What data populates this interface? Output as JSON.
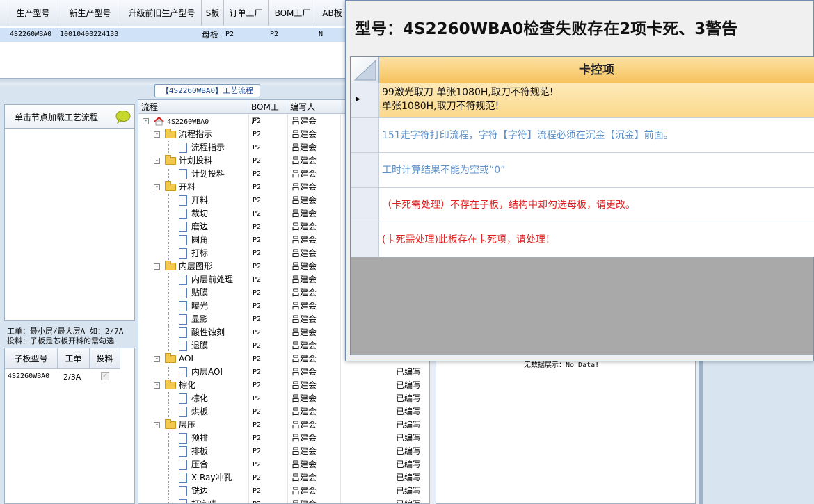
{
  "top_grid": {
    "columns": [
      "生产型号",
      "新生产型号",
      "升级前旧生产型号",
      "S板",
      "订单工厂",
      "BOM工厂",
      "AB板"
    ],
    "row": [
      "4S2260WBA0",
      "10010400224133",
      "",
      "母板",
      "P2",
      "P2",
      "N"
    ]
  },
  "left_panel": {
    "header": "单击节点加载工艺流程",
    "hint_line1": "工单：最小层/最大层A 如：2/7A",
    "hint_line2": "投料：子板是芯板开料的需勾选",
    "sub_grid": {
      "columns": [
        "子板型号",
        "工单",
        "投料"
      ],
      "row": [
        "4S2260WBA0",
        "2/3A",
        "✓"
      ]
    }
  },
  "process": {
    "title": "【4S2260WBA0】工艺流程",
    "columns": [
      "流程",
      "BOM工厂",
      "编写人"
    ],
    "root": "4S2260WBA0",
    "bom": "P2",
    "writer": "吕建会",
    "status": "已编写",
    "nodes": [
      {
        "name": "流程指示",
        "level": 1
      },
      {
        "name": "流程指示",
        "level": 2
      },
      {
        "name": "计划投料",
        "level": 1
      },
      {
        "name": "计划投料",
        "level": 2
      },
      {
        "name": "开料",
        "level": 1
      },
      {
        "name": "开料",
        "level": 2
      },
      {
        "name": "裁切",
        "level": 2
      },
      {
        "name": "磨边",
        "level": 2
      },
      {
        "name": "圆角",
        "level": 2
      },
      {
        "name": "打标",
        "level": 2
      },
      {
        "name": "内层图形",
        "level": 1
      },
      {
        "name": "内层前处理",
        "level": 2
      },
      {
        "name": "贴膜",
        "level": 2
      },
      {
        "name": "曝光",
        "level": 2
      },
      {
        "name": "显影",
        "level": 2
      },
      {
        "name": "酸性蚀刻",
        "level": 2
      },
      {
        "name": "退膜",
        "level": 2
      },
      {
        "name": "AOI",
        "level": 1
      },
      {
        "name": "内层AOI",
        "level": 2
      },
      {
        "name": "棕化",
        "level": 1
      },
      {
        "name": "棕化",
        "level": 2
      },
      {
        "name": "烘板",
        "level": 2
      },
      {
        "name": "层压",
        "level": 1
      },
      {
        "name": "预排",
        "level": 2
      },
      {
        "name": "排板",
        "level": 2
      },
      {
        "name": "压合",
        "level": 2
      },
      {
        "name": "X-Ray冲孔",
        "level": 2
      },
      {
        "name": "铣边",
        "level": 2
      },
      {
        "name": "打字唛",
        "level": 2
      }
    ],
    "status_start_index": 18
  },
  "middle": {
    "empty_text": "无数据展示：No Data!"
  },
  "dialog": {
    "title": "型号：4S2260WBA0检查失败存在2项卡死、3警告",
    "header": "卡控项",
    "colors": {
      "warning": "#5b8fc9",
      "error": "#e02020",
      "selected": "#fbd98c"
    },
    "rows": [
      {
        "text": "99激光取刀 单张1080H,取刀不符规范!",
        "text2": "单张1080H,取刀不符规范!",
        "kind": "selected"
      },
      {
        "text": "151走字符打印流程，字符【字符】流程必须在沉金【沉金】前面。",
        "text2": "",
        "kind": "warning"
      },
      {
        "text": "工时计算结果不能为空或“0”",
        "text2": "",
        "kind": "warning"
      },
      {
        "text": "（卡死需处理）不存在子板，结构中却勾选母板，请更改。",
        "text2": "",
        "kind": "error"
      },
      {
        "text": "(卡死需处理)此板存在卡死项，请处理！",
        "text2": "",
        "kind": "error"
      }
    ]
  }
}
